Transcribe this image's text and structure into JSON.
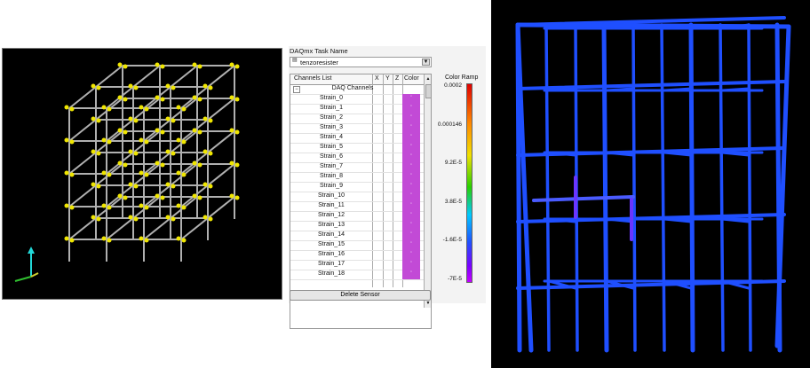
{
  "daqmx": {
    "task_label": "DAQmx Task Name",
    "task_icon": "task-list-icon",
    "task_value": "tenzoresister"
  },
  "table": {
    "headers": [
      "Channels List",
      "X",
      "Y",
      "Z",
      "Color"
    ],
    "group_label": "DAQ Channels",
    "rows": [
      "Strain_0",
      "Strain_1",
      "Strain_2",
      "Strain_3",
      "Strain_4",
      "Strain_5",
      "Strain_6",
      "Strain_7",
      "Strain_8",
      "Strain_9",
      "Strain_10",
      "Strain_11",
      "Strain_12",
      "Strain_13",
      "Strain_14",
      "Strain_15",
      "Strain_16",
      "Strain_17",
      "Strain_18"
    ],
    "swatch_color": "#c24ad6"
  },
  "delete_label": "Delete Sensor",
  "ramp": {
    "title": "Color Ramp",
    "ticks": [
      "0.0002",
      "0.000146",
      "9.2E-5",
      "3.8E-5",
      "-1.6E-5",
      "-7E-5"
    ]
  },
  "colors": {
    "frame_gray": "#b0b0b0",
    "sensor_yellow": "#f0e600",
    "tube_blue": "#1f4fff"
  }
}
